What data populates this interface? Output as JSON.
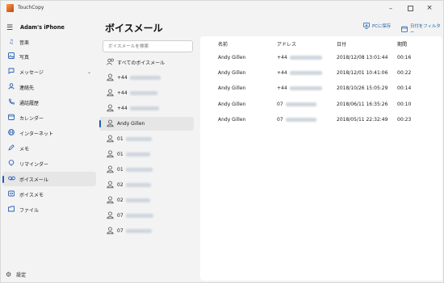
{
  "window": {
    "app_title": "TouchCopy"
  },
  "sidebar": {
    "device_name": "Adam's iPhone",
    "items": [
      {
        "label": "音楽",
        "icon": "music-note-icon"
      },
      {
        "label": "写真",
        "icon": "photo-icon"
      },
      {
        "label": "メッセージ",
        "icon": "chat-bubble-icon"
      },
      {
        "label": "連絡先",
        "icon": "person-icon"
      },
      {
        "label": "通話履歴",
        "icon": "call-log-icon"
      },
      {
        "label": "カレンダー",
        "icon": "calendar-icon"
      },
      {
        "label": "インターネット",
        "icon": "globe-icon"
      },
      {
        "label": "メモ",
        "icon": "note-icon"
      },
      {
        "label": "リマインダー",
        "icon": "reminder-icon"
      },
      {
        "label": "ボイスメール",
        "icon": "voicemail-icon"
      },
      {
        "label": "ボイスメモ",
        "icon": "voice-memo-icon"
      },
      {
        "label": "ファイル",
        "icon": "folder-icon"
      }
    ],
    "settings_label": "設定"
  },
  "header": {
    "title": "ボイスメール",
    "save_pc_label": "PCに保存",
    "filter_label": "日付をフィルター"
  },
  "contacts": {
    "search_placeholder": "ボイスメールを検索",
    "all_label": "すべてのボイスメール",
    "items": [
      {
        "label": "+44"
      },
      {
        "label": "+44"
      },
      {
        "label": "+44"
      },
      {
        "label": "Andy Gillen"
      },
      {
        "label": "01"
      },
      {
        "label": "01"
      },
      {
        "label": "01"
      },
      {
        "label": "02"
      },
      {
        "label": "02"
      },
      {
        "label": "07"
      },
      {
        "label": "07"
      }
    ]
  },
  "table": {
    "columns": [
      "名前",
      "アドレス",
      "日付",
      "期間"
    ],
    "rows": [
      {
        "name": "Andy Gillen",
        "address": "+44",
        "date": "2018/12/08 13:01:44",
        "duration": "00:16"
      },
      {
        "name": "Andy Gillen",
        "address": "+44",
        "date": "2018/12/01 10:41:06",
        "duration": "00:22"
      },
      {
        "name": "Andy Gillen",
        "address": "+44",
        "date": "2018/10/26 15:05:29",
        "duration": "00:14"
      },
      {
        "name": "Andy Gillen",
        "address": "07",
        "date": "2018/06/11 16:35:26",
        "duration": "00:10"
      },
      {
        "name": "Andy Gillen",
        "address": "07",
        "date": "2018/05/11 22:32:49",
        "duration": "00:23"
      }
    ]
  }
}
